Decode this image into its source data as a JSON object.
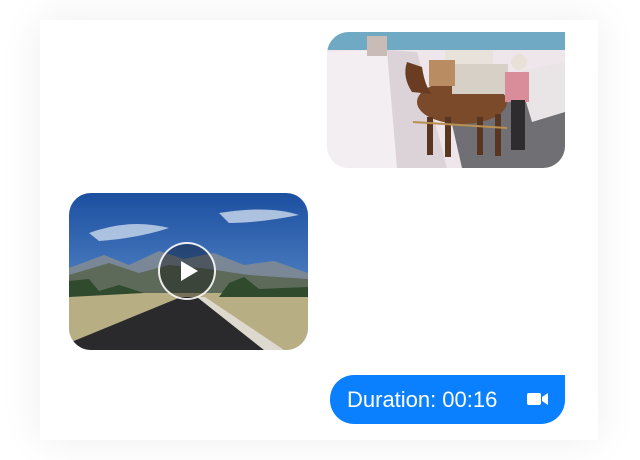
{
  "messages": {
    "photo": {
      "type": "image",
      "subject": "mule-carrying-boxes"
    },
    "video": {
      "type": "video",
      "subject": "mountain-road"
    },
    "duration": {
      "label": "Duration:",
      "value": "00:16",
      "icon": "video-camera-icon"
    }
  },
  "colors": {
    "accent": "#0a80ff",
    "bubble_text": "#ffffff"
  }
}
